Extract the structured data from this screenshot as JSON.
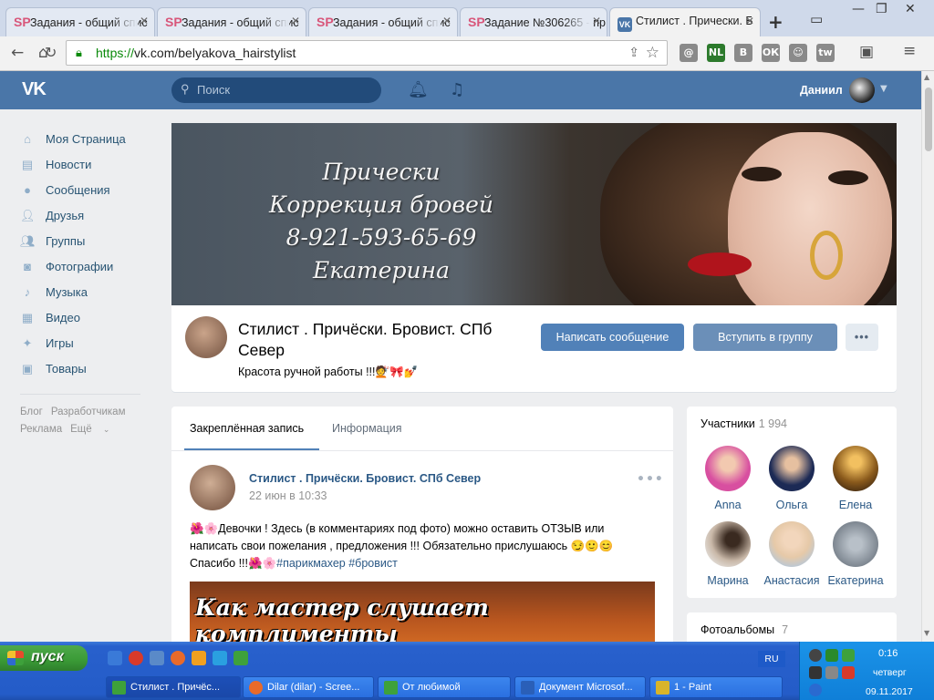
{
  "browser": {
    "tabs": [
      {
        "favicon": "SP",
        "title": "Задания - общий спис"
      },
      {
        "favicon": "SP",
        "title": "Задания - общий спис"
      },
      {
        "favicon": "SP",
        "title": "Задания - общий спис"
      },
      {
        "favicon": "SP",
        "title": "Задание №306265 - пр"
      },
      {
        "favicon": "VK",
        "title": "Стилист . Прически. Б"
      }
    ],
    "url_scheme": "https://",
    "url_rest": "vk.com/belyakova_hairstylist",
    "extensions": [
      "@",
      "NL",
      "B",
      "ОК",
      "☺",
      "tw"
    ]
  },
  "vk": {
    "logo": "VK",
    "search_placeholder": "Поиск",
    "user_name": "Даниил",
    "menu": [
      {
        "icon": "home-icon",
        "label": "Моя Страница"
      },
      {
        "icon": "news-icon",
        "label": "Новости"
      },
      {
        "icon": "messages-icon",
        "label": "Сообщения"
      },
      {
        "icon": "friends-icon",
        "label": "Друзья"
      },
      {
        "icon": "groups-icon",
        "label": "Группы"
      },
      {
        "icon": "photo-icon",
        "label": "Фотографии"
      },
      {
        "icon": "music-icon",
        "label": "Музыка"
      },
      {
        "icon": "video-icon",
        "label": "Видео"
      },
      {
        "icon": "games-icon",
        "label": "Игры"
      },
      {
        "icon": "goods-icon",
        "label": "Товары"
      }
    ],
    "footer_links": [
      "Блог",
      "Разработчикам",
      "Реклама",
      "Ещё"
    ]
  },
  "group": {
    "cover_lines": [
      "Прически",
      "Коррекция бровей",
      "8-921-593-65-69",
      "Екатерина"
    ],
    "title": "Стилист . Причёски. Бровист. СПб Север",
    "status": "Красота ручной работы !!!💇🎀💅",
    "btn_message": "Написать сообщение",
    "btn_join": "Вступить в группу",
    "btn_more": "•••"
  },
  "wall": {
    "tab_pinned": "Закреплённая запись",
    "tab_info": "Информация",
    "post_author": "Стилист . Причёски. Бровист. СПб Север",
    "post_date": "22 июн в 10:33",
    "post_text_1": "🌺🌸Девочки ! Здесь (в комментариях под фото) можно оставить ОТЗЫВ или написать свои пожелания , предложения !!! Обязательно прислушаюсь 😏🙂😊 Спасибо !!!🌺🌸",
    "post_tags": "#парикмахер #бровист",
    "post_image_caption": "Как мастер слушает комплименты"
  },
  "members": {
    "title": "Участники",
    "count": "1 994",
    "people": [
      {
        "name": "Anna",
        "color": "#d84fa0"
      },
      {
        "name": "Ольга",
        "color": "#1c2a55"
      },
      {
        "name": "Елена",
        "color": "#8a5a1c"
      },
      {
        "name": "Марина",
        "color": "#c9b8a8"
      },
      {
        "name": "Анастасия",
        "color": "#e6c9a8"
      },
      {
        "name": "Екатерина",
        "color": "#7d8690"
      }
    ]
  },
  "albums": {
    "title": "Фотоальбомы",
    "count": "7"
  },
  "taskbar": {
    "start": "пуск",
    "lang": "RU",
    "time": "0:16",
    "day": "четверг",
    "date": "09.11.2017",
    "tasks": [
      {
        "label": "Стилист . Причёс...",
        "color": "#3ea13b"
      },
      {
        "label": "Dilar (dilar) - Scree...",
        "color": "#e86a2a"
      },
      {
        "label": "От любимой",
        "color": "#3ea13b"
      },
      {
        "label": "Документ Microsof...",
        "color": "#2a5fb8"
      },
      {
        "label": "1 - Paint",
        "color": "#d8b42a"
      }
    ]
  }
}
